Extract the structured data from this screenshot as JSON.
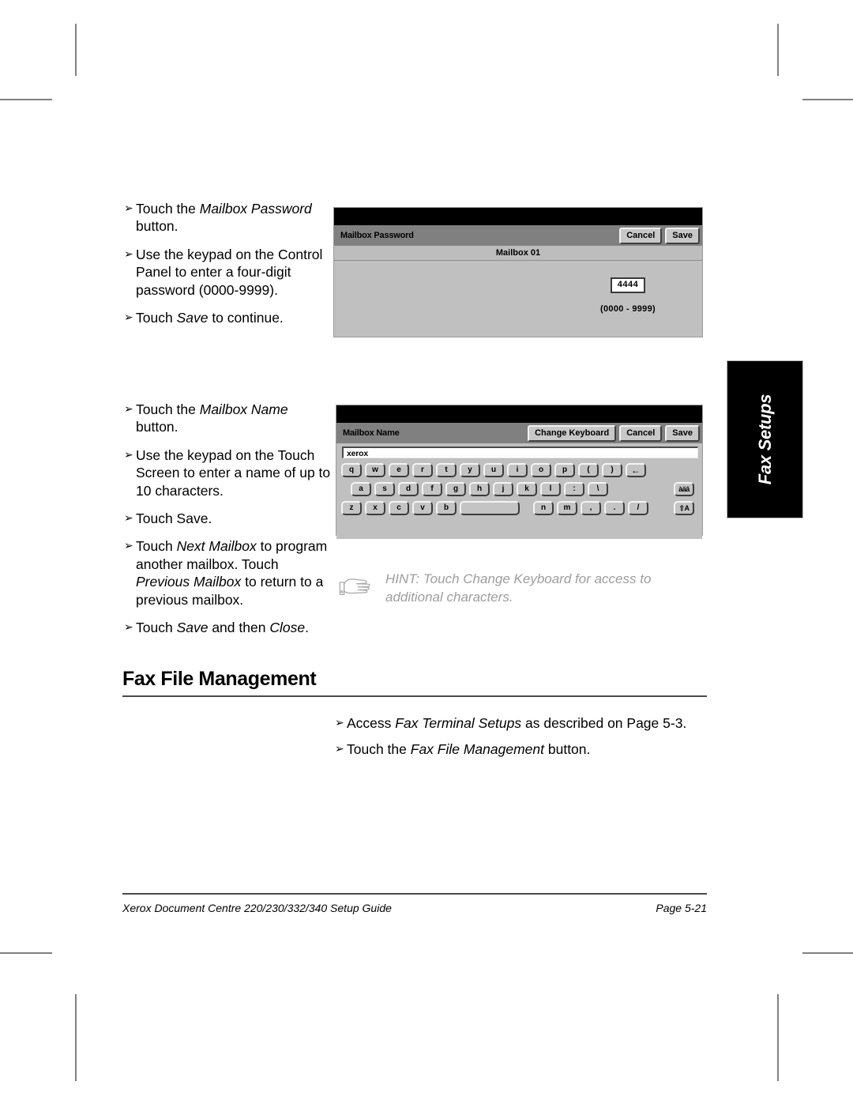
{
  "document": {
    "footer_left": "Xerox Document Centre 220/230/332/340 Setup Guide",
    "footer_right": "Page 5-21",
    "side_tab": "Fax Setups"
  },
  "section_password": {
    "steps": [
      {
        "bullet": "➢",
        "parts": [
          {
            "t": "Touch the ",
            "i": false
          },
          {
            "t": "Mailbox Password",
            "i": true
          },
          {
            "t": " button.",
            "i": false
          }
        ]
      },
      {
        "bullet": "➢",
        "parts": [
          {
            "t": "Use the keypad on the Control Panel to enter a four-digit password (0000-9999).",
            "i": false
          }
        ]
      },
      {
        "bullet": "➢",
        "parts": [
          {
            "t": "Touch ",
            "i": false
          },
          {
            "t": "Save",
            "i": true
          },
          {
            "t": " to continue.",
            "i": false
          }
        ]
      }
    ],
    "ui": {
      "title": "Mailbox Password",
      "buttons": [
        "Cancel",
        "Save"
      ],
      "subtitle": "Mailbox 01",
      "value": "4444",
      "range": "(0000 - 9999)"
    }
  },
  "section_name": {
    "steps": [
      {
        "bullet": "➢",
        "parts": [
          {
            "t": "Touch the ",
            "i": false
          },
          {
            "t": "Mailbox Name",
            "i": true
          },
          {
            "t": " button.",
            "i": false
          }
        ]
      },
      {
        "bullet": "➢",
        "parts": [
          {
            "t": "Use the keypad on the Touch Screen to enter a name of up to 10 characters.",
            "i": false
          }
        ]
      },
      {
        "bullet": "➢",
        "parts": [
          {
            "t": "Touch Save.",
            "i": false
          }
        ]
      },
      {
        "bullet": "➢",
        "parts": [
          {
            "t": "Touch ",
            "i": false
          },
          {
            "t": "Next Mailbox",
            "i": true
          },
          {
            "t": " to program another mailbox. Touch ",
            "i": false
          },
          {
            "t": "Previous Mailbox",
            "i": true
          },
          {
            "t": " to return to a previous mailbox.",
            "i": false
          }
        ]
      },
      {
        "bullet": "➢",
        "parts": [
          {
            "t": "Touch ",
            "i": false
          },
          {
            "t": "Save",
            "i": true
          },
          {
            "t": " and then ",
            "i": false
          },
          {
            "t": "Close",
            "i": true
          },
          {
            "t": ".",
            "i": false
          }
        ]
      }
    ],
    "ui": {
      "title": "Mailbox Name",
      "buttons": [
        "Change Keyboard",
        "Cancel",
        "Save"
      ],
      "field_value": "xerox",
      "keyboard": {
        "row1": [
          "q",
          "w",
          "e",
          "r",
          "t",
          "y",
          "u",
          "i",
          "o",
          "p",
          "(",
          ")"
        ],
        "row1_last": "←",
        "row2": [
          "a",
          "s",
          "d",
          "f",
          "g",
          "h",
          "j",
          "k",
          "l",
          ":",
          "\\"
        ],
        "row2_last": "àäâ",
        "row3_left": [
          "z",
          "x",
          "c",
          "v",
          "b"
        ],
        "row3_space": " ",
        "row3_right": [
          "n",
          "m",
          ",",
          ".",
          "/"
        ],
        "row3_last": "⇧A"
      }
    },
    "hint": {
      "icon": "pointing-hand-icon",
      "text": "HINT: Touch Change Keyboard for access to additional characters."
    }
  },
  "section_fax_file_management": {
    "title": "Fax File Management",
    "steps": [
      {
        "bullet": "➢",
        "parts": [
          {
            "t": "Access ",
            "i": false
          },
          {
            "t": "Fax Terminal Setups",
            "i": true
          },
          {
            "t": " as described on Page 5-3.",
            "i": false
          }
        ]
      },
      {
        "bullet": "➢",
        "parts": [
          {
            "t": "Touch the ",
            "i": false
          },
          {
            "t": "Fax File Management",
            "i": true
          },
          {
            "t": " button.",
            "i": false
          }
        ]
      }
    ]
  },
  "colors": {
    "panel_bg": "#c0c0c0",
    "titlebar": "#808080",
    "topbar": "#000000",
    "hint_text": "#9d9d9d"
  }
}
